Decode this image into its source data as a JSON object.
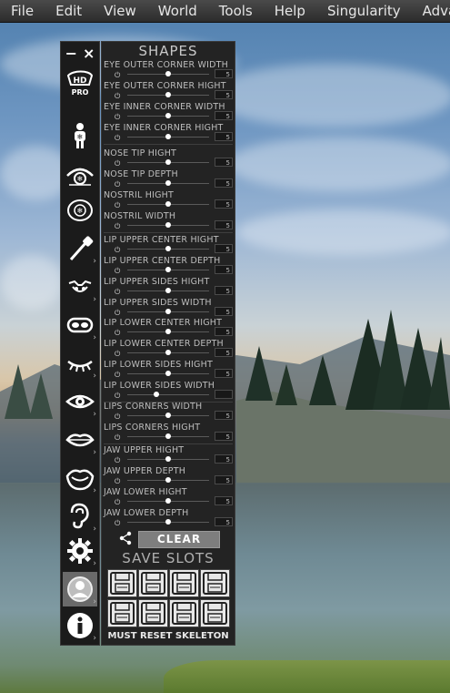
{
  "menubar": {
    "items": [
      "File",
      "Edit",
      "View",
      "World",
      "Tools",
      "Help",
      "Singularity",
      "Advar"
    ]
  },
  "toolbar": {
    "top": {
      "minimize": "−",
      "close": "×"
    },
    "hd_logo": {
      "hd": "HD",
      "pro": "PRO"
    }
  },
  "panel": {
    "title": "SHAPES",
    "rows": [
      {
        "label": "EYE OUTER CORNER WIDTH",
        "value": "5",
        "level": 0.5
      },
      {
        "label": "EYE OUTER CORNER HIGHT",
        "value": "5",
        "level": 0.5
      },
      {
        "label": "EYE INNER CORNER WIDTH",
        "value": "5",
        "level": 0.5
      },
      {
        "label": "EYE INNER CORNER HIGHT",
        "value": "5",
        "level": 0.5
      },
      {
        "label": "NOSE TIP HIGHT",
        "value": "5",
        "level": 0.5
      },
      {
        "label": "NOSE TIP DEPTH",
        "value": "5",
        "level": 0.5
      },
      {
        "label": "NOSTRIL HIGHT",
        "value": "5",
        "level": 0.5
      },
      {
        "label": "NOSTRIL WIDTH",
        "value": "5",
        "level": 0.5
      },
      {
        "label": "LIP UPPER CENTER HIGHT",
        "value": "5",
        "level": 0.5
      },
      {
        "label": "LIP UPPER CENTER DEPTH",
        "value": "5",
        "level": 0.5
      },
      {
        "label": "LIP UPPER SIDES HIGHT",
        "value": "5",
        "level": 0.5
      },
      {
        "label": "LIP UPPER SIDES WIDTH",
        "value": "5",
        "level": 0.5
      },
      {
        "label": "LIP LOWER CENTER HIGHT",
        "value": "5",
        "level": 0.5
      },
      {
        "label": "LIP LOWER CENTER DEPTH",
        "value": "5",
        "level": 0.5
      },
      {
        "label": "LIP LOWER SIDES HIGHT",
        "value": "5",
        "level": 0.5
      },
      {
        "label": "LIP LOWER SIDES WIDTH",
        "value": "",
        "level": 0.35
      },
      {
        "label": "LIPS CORNERS WIDTH",
        "value": "5",
        "level": 0.5
      },
      {
        "label": "LIPS CORNERS HIGHT",
        "value": "5",
        "level": 0.5
      },
      {
        "label": "JAW UPPER HIGHT",
        "value": "5",
        "level": 0.5
      },
      {
        "label": "JAW UPPER DEPTH",
        "value": "5",
        "level": 0.5
      },
      {
        "label": "JAW LOWER HIGHT",
        "value": "5",
        "level": 0.5
      },
      {
        "label": "JAW LOWER DEPTH",
        "value": "5",
        "level": 0.5
      }
    ],
    "clear_label": "CLEAR",
    "save_title": "SAVE SLOTS",
    "footer": "MUST RESET SKELETON"
  },
  "colors": {
    "panel_bg": "#232323",
    "menubar_bg": "#2c2c2c",
    "knob": "#ffffff"
  },
  "icons": [
    "hd-pro-logo-icon",
    "body-icon",
    "eye-detail-icon",
    "mouth-detail-icon",
    "eyedropper-icon",
    "nose-icon",
    "mask-icon",
    "eyelash-icon",
    "eye-icon",
    "lips-icon",
    "open-mouth-icon",
    "ear-icon",
    "gear-icon",
    "avatar-icon",
    "info-icon",
    "share-icon",
    "save-slot-icon"
  ]
}
